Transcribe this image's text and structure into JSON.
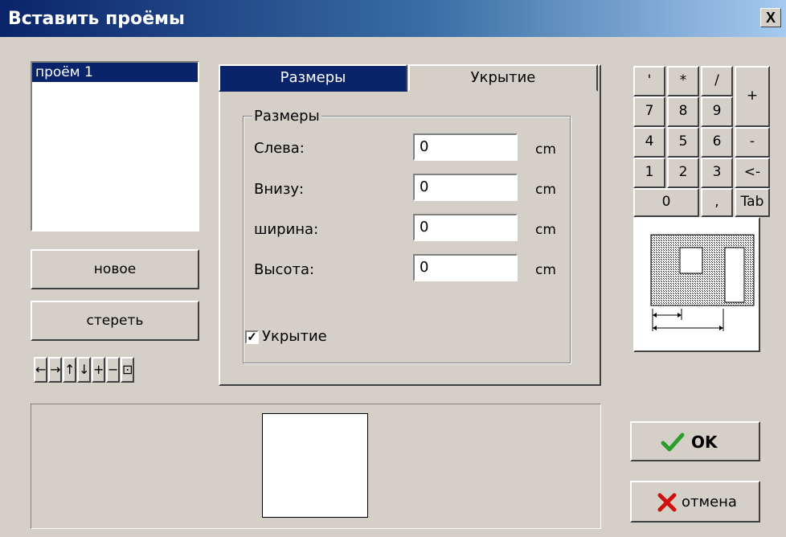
{
  "window": {
    "title": "Вставить проёмы",
    "close_glyph": "X"
  },
  "list": {
    "items": [
      "проём 1"
    ]
  },
  "buttons": {
    "new": "новое",
    "delete": "стереть"
  },
  "nav_buttons": [
    "←",
    "→",
    "↑",
    "↓",
    "+",
    "−",
    "⊡"
  ],
  "tabs": [
    {
      "label": "Размеры",
      "active": true
    },
    {
      "label": "Укрытие",
      "active": false
    }
  ],
  "sizes": {
    "group_title": "Размеры",
    "unit": "cm",
    "fields": [
      {
        "label": "Слева:",
        "value": "0"
      },
      {
        "label": "Внизу:",
        "value": "0"
      },
      {
        "label": "ширина:",
        "value": "0"
      },
      {
        "label": "Высота:",
        "value": "0"
      }
    ],
    "cover_checkbox": {
      "label": "Укрытие",
      "checked": true,
      "mark": "✓"
    }
  },
  "keypad": {
    "keys": [
      "'",
      "*",
      "/",
      "+",
      "7",
      "8",
      "9",
      "4",
      "5",
      "6",
      "-",
      "1",
      "2",
      "3",
      "<-",
      "0",
      ",",
      "Tab"
    ]
  },
  "actions": {
    "ok": "OK",
    "cancel": "отмена"
  },
  "colors": {
    "title_bar": "#0a246a",
    "selection": "#0a246a",
    "dialog": "#d4d0c8",
    "ok_icon": "#2a9d2a",
    "cancel_icon": "#d01010"
  }
}
